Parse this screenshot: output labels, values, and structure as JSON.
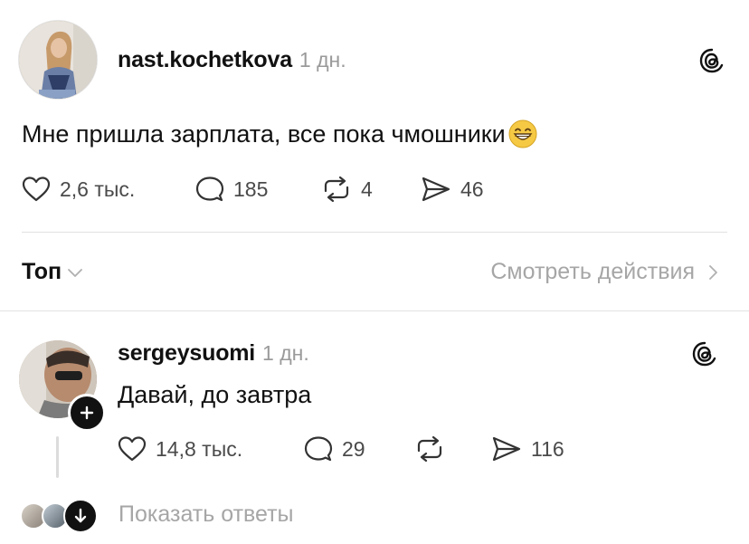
{
  "post": {
    "username": "nast.kochetkova",
    "time": "1 дн.",
    "text": "Мне пришла зарплата, все пока чмошники",
    "likes": "2,6 тыс.",
    "comments": "185",
    "reposts": "4",
    "shares": "46"
  },
  "sort": {
    "label": "Топ",
    "view_activity": "Смотреть действия"
  },
  "reply": {
    "username": "sergeysuomi",
    "time": "1 дн.",
    "text": "Давай, до завтра",
    "likes": "14,8 тыс.",
    "comments": "29",
    "reposts": "",
    "shares": "116"
  },
  "footer": {
    "show_replies": "Показать ответы"
  },
  "icons": {
    "post_avatar": "avatar",
    "threads": "threads-logo-icon",
    "like": "heart-icon",
    "comment": "comment-bubble-icon",
    "repost": "repost-icon",
    "share": "send-icon",
    "follow": "plus-icon",
    "chevron_down": "chevron-down-icon",
    "chevron_right": "chevron-right-icon",
    "arrow_down": "arrow-down-icon"
  }
}
